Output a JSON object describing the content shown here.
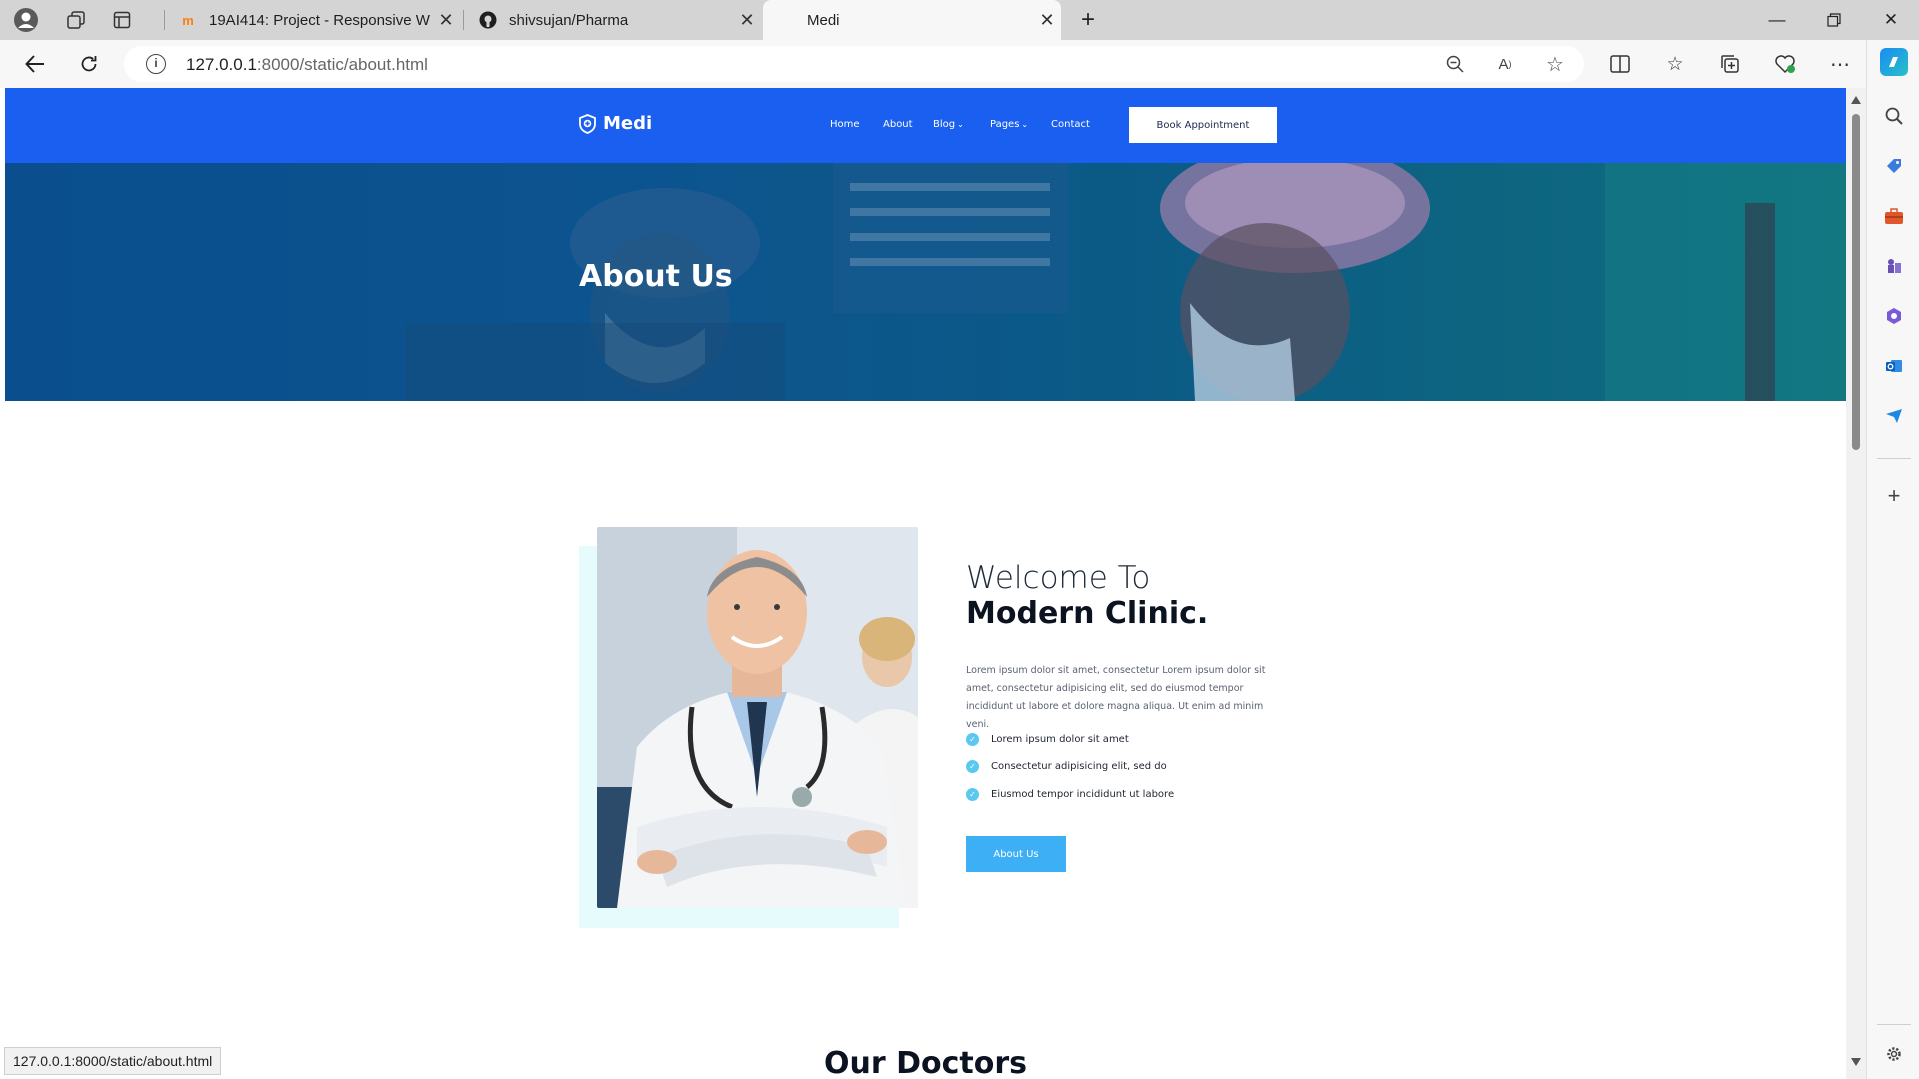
{
  "browser": {
    "tabs": [
      {
        "favicon": "moodle-icon",
        "title": "19AI414: Project - Responsive W",
        "active": false
      },
      {
        "favicon": "github-icon",
        "title": "shivsujan/Pharma",
        "active": false
      },
      {
        "favicon": "blank-icon",
        "title": "Medi",
        "active": true
      }
    ],
    "url_host": "127.0.0.1",
    "url_path": ":8000/static/about.html",
    "status_url": "127.0.0.1:8000/static/about.html"
  },
  "site": {
    "logo_text": "Medi",
    "nav": [
      {
        "label": "Home",
        "has_dropdown": false
      },
      {
        "label": "About",
        "has_dropdown": false
      },
      {
        "label": "Blog",
        "has_dropdown": true
      },
      {
        "label": "Pages",
        "has_dropdown": true
      },
      {
        "label": "Contact",
        "has_dropdown": false
      }
    ],
    "book_button": "Book Appointment",
    "hero_title": "About Us",
    "about": {
      "welcome": "Welcome To",
      "clinic": "Modern Clinic.",
      "paragraph": "Lorem ipsum dolor sit amet, consectetur Lorem ipsum dolor sit amet, consectetur adipisicing elit, sed do eiusmod tempor incididunt ut labore et dolore magna aliqua. Ut enim ad minim veni.",
      "checklist": [
        "Lorem ipsum dolor sit amet",
        "Consectetur adipisicing elit, sed do",
        "Eiusmod tempor incididunt ut labore"
      ],
      "button": "About Us"
    },
    "doctors_title": "Our Doctors"
  },
  "colors": {
    "header_blue": "#1a5fef",
    "accent_cyan": "#3db0f5",
    "check_cyan": "#5bc8f0"
  }
}
